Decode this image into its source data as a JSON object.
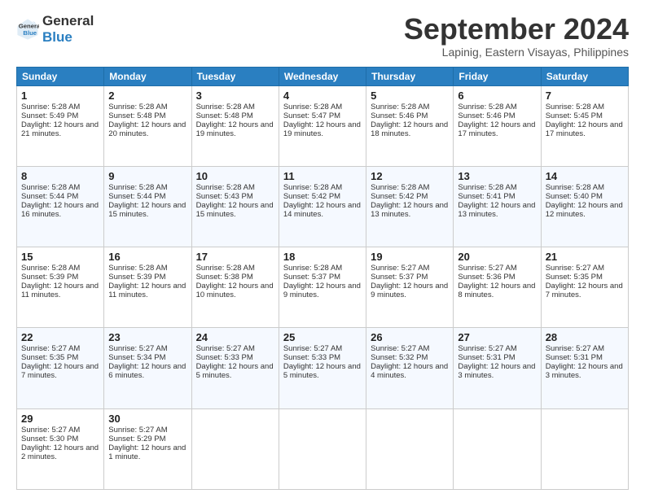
{
  "logo": {
    "line1": "General",
    "line2": "Blue"
  },
  "title": "September 2024",
  "location": "Lapinig, Eastern Visayas, Philippines",
  "days_header": [
    "Sunday",
    "Monday",
    "Tuesday",
    "Wednesday",
    "Thursday",
    "Friday",
    "Saturday"
  ],
  "weeks": [
    [
      {
        "day": "1",
        "sunrise": "Sunrise: 5:28 AM",
        "sunset": "Sunset: 5:49 PM",
        "daylight": "Daylight: 12 hours and 21 minutes."
      },
      {
        "day": "2",
        "sunrise": "Sunrise: 5:28 AM",
        "sunset": "Sunset: 5:48 PM",
        "daylight": "Daylight: 12 hours and 20 minutes."
      },
      {
        "day": "3",
        "sunrise": "Sunrise: 5:28 AM",
        "sunset": "Sunset: 5:48 PM",
        "daylight": "Daylight: 12 hours and 19 minutes."
      },
      {
        "day": "4",
        "sunrise": "Sunrise: 5:28 AM",
        "sunset": "Sunset: 5:47 PM",
        "daylight": "Daylight: 12 hours and 19 minutes."
      },
      {
        "day": "5",
        "sunrise": "Sunrise: 5:28 AM",
        "sunset": "Sunset: 5:46 PM",
        "daylight": "Daylight: 12 hours and 18 minutes."
      },
      {
        "day": "6",
        "sunrise": "Sunrise: 5:28 AM",
        "sunset": "Sunset: 5:46 PM",
        "daylight": "Daylight: 12 hours and 17 minutes."
      },
      {
        "day": "7",
        "sunrise": "Sunrise: 5:28 AM",
        "sunset": "Sunset: 5:45 PM",
        "daylight": "Daylight: 12 hours and 17 minutes."
      }
    ],
    [
      {
        "day": "8",
        "sunrise": "Sunrise: 5:28 AM",
        "sunset": "Sunset: 5:44 PM",
        "daylight": "Daylight: 12 hours and 16 minutes."
      },
      {
        "day": "9",
        "sunrise": "Sunrise: 5:28 AM",
        "sunset": "Sunset: 5:44 PM",
        "daylight": "Daylight: 12 hours and 15 minutes."
      },
      {
        "day": "10",
        "sunrise": "Sunrise: 5:28 AM",
        "sunset": "Sunset: 5:43 PM",
        "daylight": "Daylight: 12 hours and 15 minutes."
      },
      {
        "day": "11",
        "sunrise": "Sunrise: 5:28 AM",
        "sunset": "Sunset: 5:42 PM",
        "daylight": "Daylight: 12 hours and 14 minutes."
      },
      {
        "day": "12",
        "sunrise": "Sunrise: 5:28 AM",
        "sunset": "Sunset: 5:42 PM",
        "daylight": "Daylight: 12 hours and 13 minutes."
      },
      {
        "day": "13",
        "sunrise": "Sunrise: 5:28 AM",
        "sunset": "Sunset: 5:41 PM",
        "daylight": "Daylight: 12 hours and 13 minutes."
      },
      {
        "day": "14",
        "sunrise": "Sunrise: 5:28 AM",
        "sunset": "Sunset: 5:40 PM",
        "daylight": "Daylight: 12 hours and 12 minutes."
      }
    ],
    [
      {
        "day": "15",
        "sunrise": "Sunrise: 5:28 AM",
        "sunset": "Sunset: 5:39 PM",
        "daylight": "Daylight: 12 hours and 11 minutes."
      },
      {
        "day": "16",
        "sunrise": "Sunrise: 5:28 AM",
        "sunset": "Sunset: 5:39 PM",
        "daylight": "Daylight: 12 hours and 11 minutes."
      },
      {
        "day": "17",
        "sunrise": "Sunrise: 5:28 AM",
        "sunset": "Sunset: 5:38 PM",
        "daylight": "Daylight: 12 hours and 10 minutes."
      },
      {
        "day": "18",
        "sunrise": "Sunrise: 5:28 AM",
        "sunset": "Sunset: 5:37 PM",
        "daylight": "Daylight: 12 hours and 9 minutes."
      },
      {
        "day": "19",
        "sunrise": "Sunrise: 5:27 AM",
        "sunset": "Sunset: 5:37 PM",
        "daylight": "Daylight: 12 hours and 9 minutes."
      },
      {
        "day": "20",
        "sunrise": "Sunrise: 5:27 AM",
        "sunset": "Sunset: 5:36 PM",
        "daylight": "Daylight: 12 hours and 8 minutes."
      },
      {
        "day": "21",
        "sunrise": "Sunrise: 5:27 AM",
        "sunset": "Sunset: 5:35 PM",
        "daylight": "Daylight: 12 hours and 7 minutes."
      }
    ],
    [
      {
        "day": "22",
        "sunrise": "Sunrise: 5:27 AM",
        "sunset": "Sunset: 5:35 PM",
        "daylight": "Daylight: 12 hours and 7 minutes."
      },
      {
        "day": "23",
        "sunrise": "Sunrise: 5:27 AM",
        "sunset": "Sunset: 5:34 PM",
        "daylight": "Daylight: 12 hours and 6 minutes."
      },
      {
        "day": "24",
        "sunrise": "Sunrise: 5:27 AM",
        "sunset": "Sunset: 5:33 PM",
        "daylight": "Daylight: 12 hours and 5 minutes."
      },
      {
        "day": "25",
        "sunrise": "Sunrise: 5:27 AM",
        "sunset": "Sunset: 5:33 PM",
        "daylight": "Daylight: 12 hours and 5 minutes."
      },
      {
        "day": "26",
        "sunrise": "Sunrise: 5:27 AM",
        "sunset": "Sunset: 5:32 PM",
        "daylight": "Daylight: 12 hours and 4 minutes."
      },
      {
        "day": "27",
        "sunrise": "Sunrise: 5:27 AM",
        "sunset": "Sunset: 5:31 PM",
        "daylight": "Daylight: 12 hours and 3 minutes."
      },
      {
        "day": "28",
        "sunrise": "Sunrise: 5:27 AM",
        "sunset": "Sunset: 5:31 PM",
        "daylight": "Daylight: 12 hours and 3 minutes."
      }
    ],
    [
      {
        "day": "29",
        "sunrise": "Sunrise: 5:27 AM",
        "sunset": "Sunset: 5:30 PM",
        "daylight": "Daylight: 12 hours and 2 minutes."
      },
      {
        "day": "30",
        "sunrise": "Sunrise: 5:27 AM",
        "sunset": "Sunset: 5:29 PM",
        "daylight": "Daylight: 12 hours and 1 minute."
      },
      null,
      null,
      null,
      null,
      null
    ]
  ]
}
